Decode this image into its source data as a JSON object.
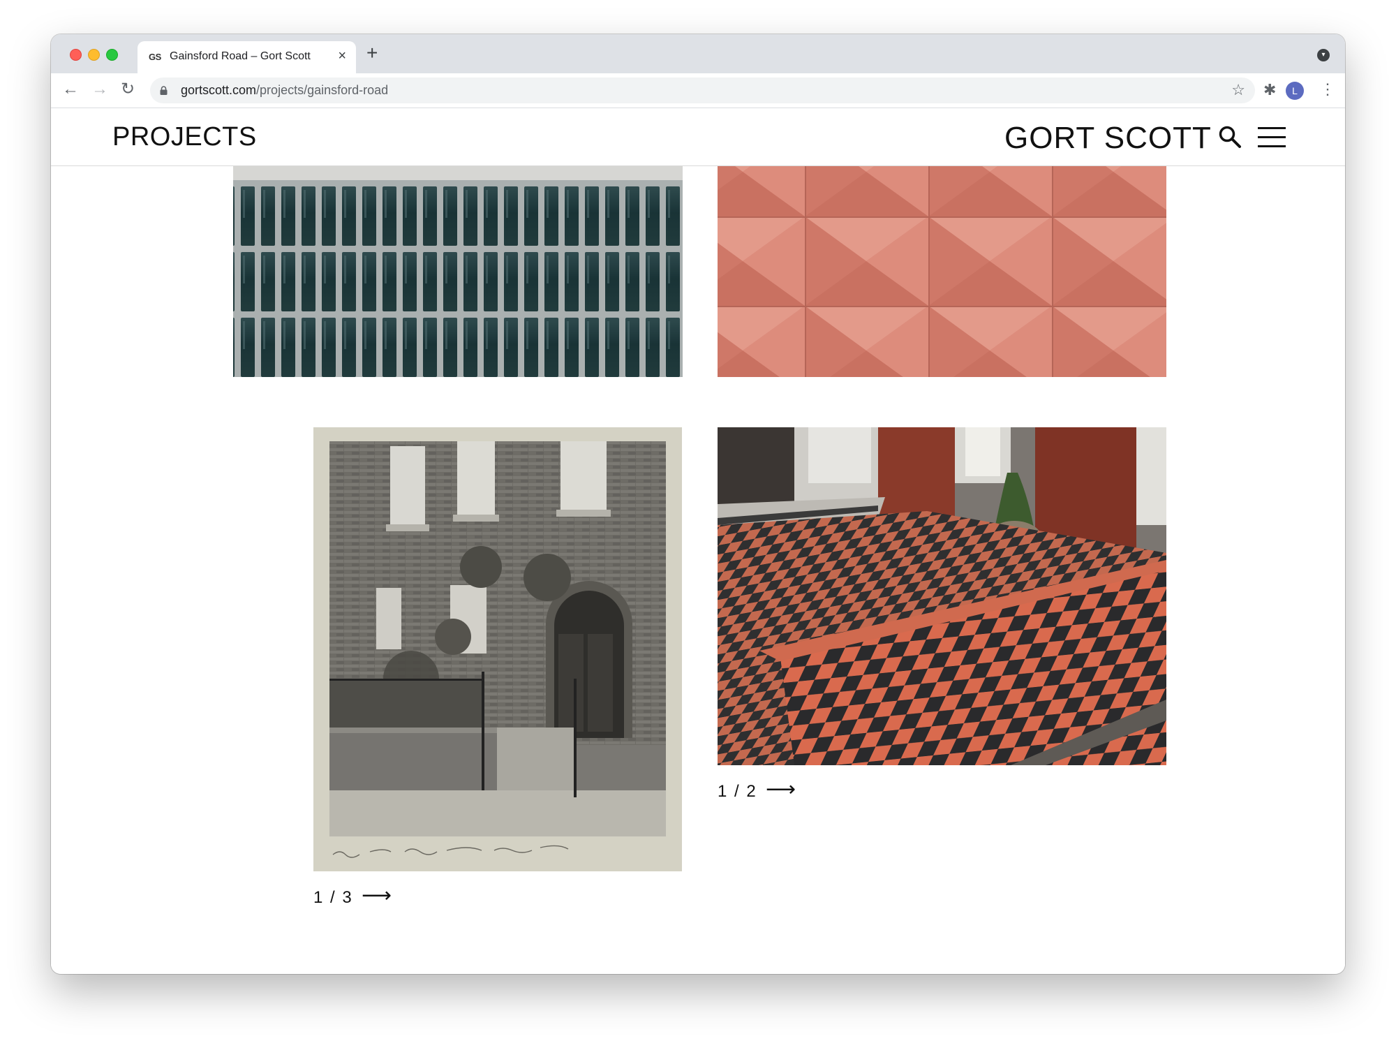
{
  "browser": {
    "tab": {
      "favicon": "GS",
      "title": "Gainsford Road – Gort Scott",
      "close_glyph": "×"
    },
    "new_tab_glyph": "+",
    "tab_menu_glyph": "▾",
    "nav": {
      "back": "←",
      "forward": "→",
      "reload": "↻"
    },
    "url": {
      "host": "gortscott.com",
      "path": "/projects/gainsford-road"
    },
    "star_glyph": "☆",
    "extension_glyph": "✱",
    "profile_initial": "L",
    "menu_glyph": "⋮"
  },
  "site": {
    "section_title": "PROJECTS",
    "logo": "GORT SCOTT",
    "icons": [
      "search-icon",
      "hamburger-menu-icon"
    ],
    "galleries": [
      {
        "pager": "1 / 3",
        "arrow": "⟶"
      },
      {
        "pager": "1 / 2",
        "arrow": "⟶"
      }
    ]
  },
  "colors": {
    "tabstrip": "#dee1e6",
    "terracotta": "#d98474",
    "tile_red": "#d96a4e",
    "tile_dark": "#2a2a2c",
    "glaze": "#1f3b3e"
  }
}
